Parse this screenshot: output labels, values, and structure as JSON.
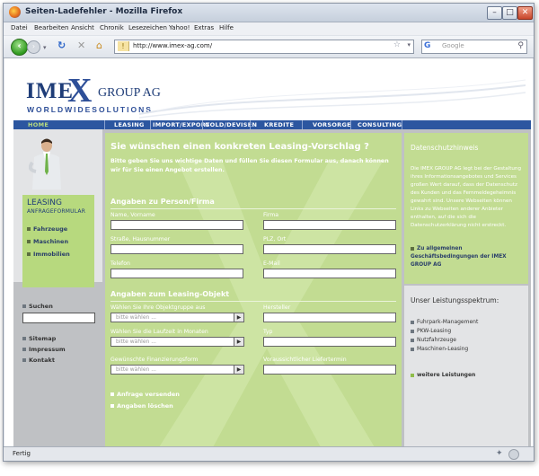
{
  "window": {
    "title": "Seiten-Ladefehler - Mozilla Firefox",
    "status": "Fertig"
  },
  "menubar": [
    "Datei",
    "Bearbeiten",
    "Ansicht",
    "Chronik",
    "Lesezeichen",
    "Yahoo!",
    "Extras",
    "Hilfe"
  ],
  "nav": {
    "url": "http://www.imex-ag.com/",
    "search_placeholder": "Google"
  },
  "logo": {
    "imex": "IME",
    "x": "X",
    "group": "GROUP AG",
    "worldwide": "WORLDWIDESOLUTIONS"
  },
  "topnav": [
    "HOME",
    "LEASING",
    "IMPORT/EXPORT",
    "GOLD/DEVISEN",
    "KREDITE",
    "VORSORGE",
    "CONSULTING"
  ],
  "leftnav": {
    "title": "LEASING",
    "subtitle": "ANFRAGEFORMULAR",
    "items": [
      "Fahrzeuge",
      "Maschinen",
      "Immobilien"
    ],
    "search_label": "Suchen",
    "links": [
      "Sitemap",
      "Impressum",
      "Kontakt"
    ]
  },
  "form": {
    "title": "Sie wünschen einen konkreten Leasing-Vorschlag ?",
    "intro": "Bitte geben Sie uns wichtige Daten und füllen Sie diesen Formular aus, danach können wir für Sie einen Angebot erstellen.",
    "section1": "Angaben zu Person/Firma",
    "name_label": "Name, Vorname",
    "firma_label": "Firma",
    "street_label": "Straße, Hausnummer",
    "plz_label": "PLZ, Ort",
    "telefon_label": "Telefon",
    "email_label": "E-Mail",
    "section2": "Angaben zum Leasing-Objekt",
    "objektgruppe_label": "Wählen Sie Ihre Objektgruppe aus",
    "hersteller_label": "Hersteller",
    "laufzeit_label": "Wählen Sie die Laufzeit in Monaten",
    "typ_label": "Typ",
    "finanzierung_label": "Gewünschte Finanzierungsform",
    "liefertermin_label": "Voraussichtlicher Liefertermin",
    "select_placeholder": "bitte wählen ...",
    "send": "Anfrage versenden",
    "clear": "Angaben löschen"
  },
  "privacy": {
    "title": "Datenschutzhinweis",
    "text": "Die IMEX GROUP AG legt bei der Gestaltung ihres Informationsangebotes und Services großen Wert darauf, dass der Datenschutz des Kunden und das Fernmeldegeheimnis gewahrt sind. Unsere Webseiten können Links zu Webseiten anderer Anbieter enthalten, auf die sich die Datenschutzerklärung nicht erstreckt.",
    "link": "Zu allgemeinen Geschäftsbedingungen der IMEX GROUP AG"
  },
  "services": {
    "title": "Unser Leistungsspektrum:",
    "items": [
      "Fuhrpark-Management",
      "PKW-Leasing",
      "Nutzfahrzeuge",
      "Maschinen-Leasing"
    ],
    "more": "weitere Leistungen"
  },
  "colors": {
    "brand_blue": "#2c56a0",
    "panel_green": "#c2dc92",
    "leasing_green": "#b7d97e"
  }
}
